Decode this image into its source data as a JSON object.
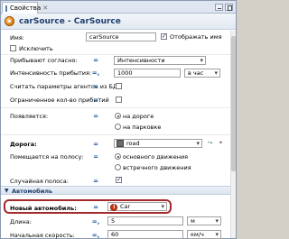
{
  "window": {
    "tab_label": "Свойства",
    "title": "carSource - CarSource"
  },
  "fields": {
    "name": {
      "label": "Имя:",
      "value": "carSource"
    },
    "show_name": {
      "label": "Отображать имя",
      "checked": true
    },
    "exclude": {
      "label": "Исключить",
      "checked": false
    },
    "arrivals_by": {
      "label": "Прибывают согласно:",
      "value": "Интенсивности"
    },
    "arrival_rate": {
      "label": "Интенсивность прибытия:",
      "value": "1000",
      "unit": "в час"
    },
    "read_params_db": {
      "label": "Считать параметры агентов из БД:",
      "checked": false
    },
    "limit_arrivals": {
      "label": "Ограниченное кол-во прибытий",
      "checked": false
    },
    "appear": {
      "label": "Появляется:",
      "options": [
        "на дороге",
        "на парковке"
      ],
      "selected_index": 0
    },
    "road": {
      "label": "Дорога:",
      "value": "road"
    },
    "place_in_lane": {
      "label": "Помещается на полосу:",
      "options": [
        "основного движения",
        "встречного движения"
      ],
      "selected_index": 0
    },
    "random_lane": {
      "label": "Случайная полоса:",
      "checked": true
    }
  },
  "section": {
    "label": "Автомобиль"
  },
  "vehicle": {
    "new_car": {
      "label": "Новый автомобиль:",
      "value": "Car"
    },
    "length": {
      "label": "Длина:",
      "value": "5",
      "unit": "м"
    },
    "initial_speed": {
      "label": "Начальная скорость:",
      "value": "60",
      "unit": "км/ч"
    }
  },
  "icons": {
    "equals": "=",
    "dynamic": "=,"
  }
}
